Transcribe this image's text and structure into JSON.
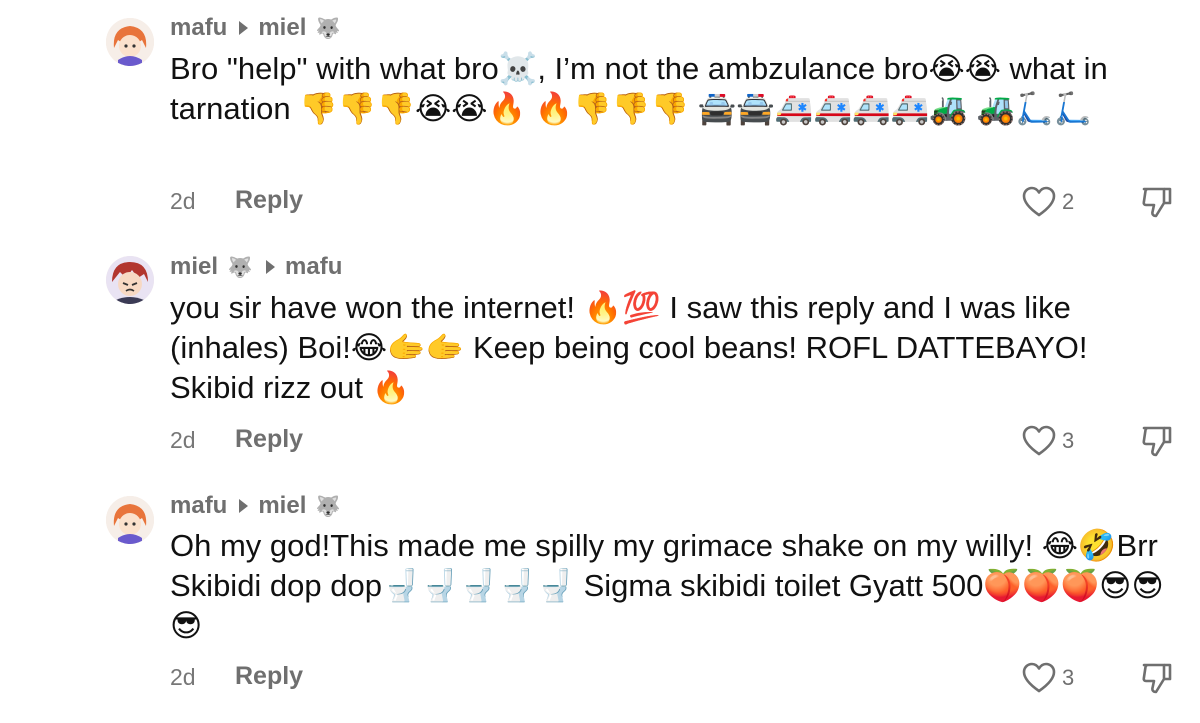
{
  "comments": [
    {
      "author": "mafu",
      "reply_to": "miel",
      "reply_to_badge": "🐺",
      "author_badge": "",
      "text": "Bro \"help\" with what bro☠️, I’m not the ambzulance bro😭😭 what in tarnation 👎👎👎😭😭🔥 🔥👎👎👎 🚔🚔🚑🚑🚑🚑🚜 🚜🛴🛴",
      "time": "2d",
      "reply_label": "Reply",
      "likes": "2"
    },
    {
      "author": "miel",
      "author_badge": "🐺",
      "reply_to": "mafu",
      "reply_to_badge": "",
      "text": "you sir have won the internet! 🔥💯 I saw this reply and I was like (inhales) Boi!😂🫱🫱 Keep being cool beans! ROFL DATTEBAYO! Skibid rizz out 🔥",
      "time": "2d",
      "reply_label": "Reply",
      "likes": "3"
    },
    {
      "author": "mafu",
      "reply_to": "miel",
      "reply_to_badge": "🐺",
      "author_badge": "",
      "text": "Oh my god!This made me spilly my grimace shake on my willy! 😂🤣Brr Skibidi dop dop🚽🚽🚽🚽🚽 Sigma skibidi toilet Gyatt 500🍑🍑🍑😎😎😎",
      "time": "2d",
      "reply_label": "Reply",
      "likes": "3"
    }
  ],
  "icons": {
    "like": "heart-outline-icon",
    "dislike": "thumbs-down-outline-icon",
    "arrow": "reply-arrow-icon"
  }
}
